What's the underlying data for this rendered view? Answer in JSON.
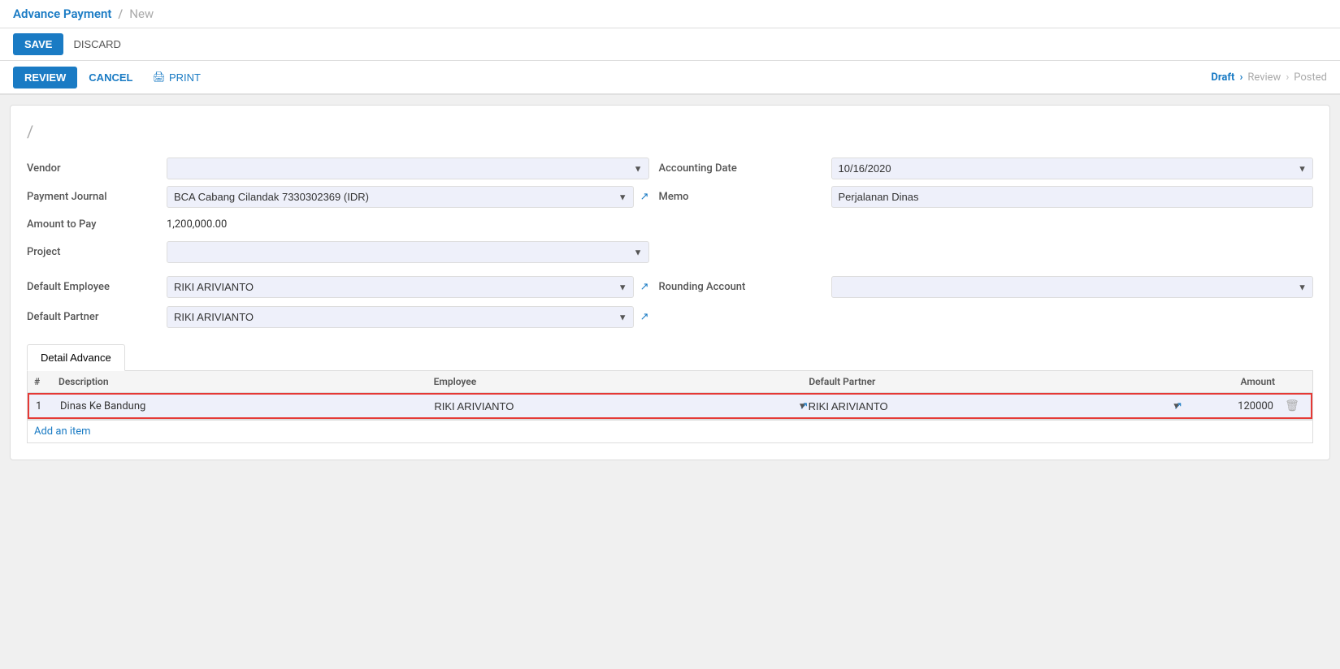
{
  "breadcrumb": {
    "main": "Advance Payment",
    "separator": "/",
    "sub": "New"
  },
  "toolbar": {
    "save_label": "SAVE",
    "discard_label": "DISCARD"
  },
  "workflow": {
    "review_label": "REVIEW",
    "cancel_label": "CANCEL",
    "print_label": "PRINT",
    "steps": [
      {
        "label": "Draft",
        "active": true
      },
      {
        "label": "Review",
        "active": false
      },
      {
        "label": "Posted",
        "active": false
      }
    ]
  },
  "form": {
    "slash": "/",
    "vendor_label": "Vendor",
    "vendor_value": "",
    "accounting_date_label": "Accounting Date",
    "accounting_date_value": "10/16/2020",
    "payment_journal_label": "Payment Journal",
    "payment_journal_value": "BCA Cabang Cilandak 7330302369 (IDR)",
    "memo_label": "Memo",
    "memo_value": "Perjalanan Dinas",
    "amount_to_pay_label": "Amount to Pay",
    "amount_to_pay_value": "1,200,000.00",
    "project_label": "Project",
    "project_value": "",
    "default_employee_label": "Default Employee",
    "default_employee_value": "RIKI ARIVIANTO",
    "rounding_account_label": "Rounding Account",
    "rounding_account_value": "",
    "default_partner_label": "Default Partner",
    "default_partner_value": "RIKI ARIVIANTO"
  },
  "tab": {
    "label": "Detail Advance"
  },
  "table": {
    "headers": [
      "#",
      "Description",
      "Employee",
      "Default Partner",
      "Amount"
    ],
    "rows": [
      {
        "num": "1",
        "description": "Dinas Ke Bandung",
        "employee": "RIKI ARIVIANTO",
        "default_partner": "RIKI ARIVIANTO",
        "amount": "120000"
      }
    ],
    "add_item_label": "Add an item"
  }
}
